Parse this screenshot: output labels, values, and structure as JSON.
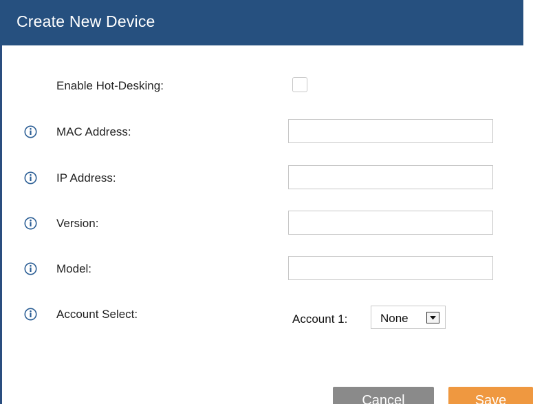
{
  "dialog": {
    "title": "Create New Device"
  },
  "form": {
    "hot_desking": {
      "label": "Enable Hot-Desking:",
      "checked": false
    },
    "mac_address": {
      "label": "MAC Address:",
      "value": ""
    },
    "ip_address": {
      "label": "IP Address:",
      "value": ""
    },
    "version": {
      "label": "Version:",
      "value": ""
    },
    "model": {
      "label": "Model:",
      "value": ""
    },
    "account_select": {
      "label": "Account Select:",
      "account_label": "Account 1:",
      "selected": "None"
    }
  },
  "buttons": {
    "cancel": "Cancel",
    "save": "Save"
  },
  "icons": {
    "info": "info-icon",
    "dropdown": "chevron-down-icon"
  },
  "colors": {
    "titlebar": "#26507f",
    "cancel": "#8a8a8a",
    "save": "#ef9840",
    "info_icon": "#2a5d94"
  }
}
